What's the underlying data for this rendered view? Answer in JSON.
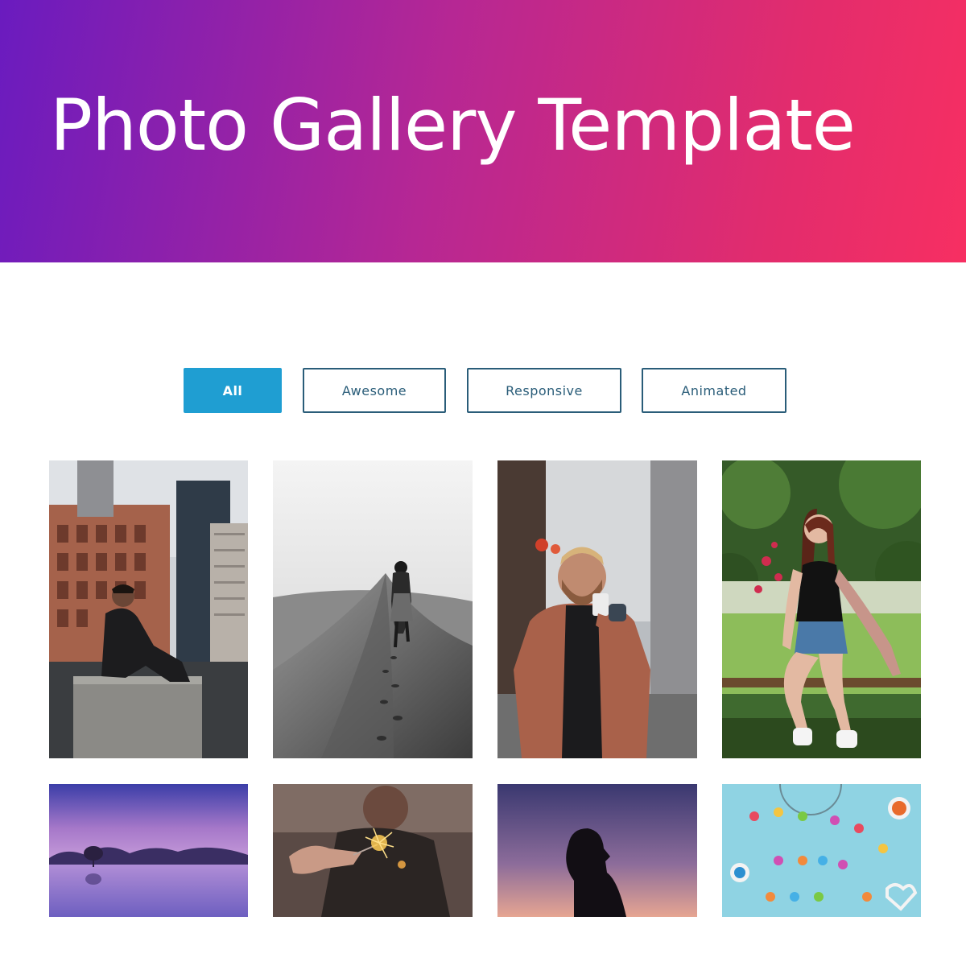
{
  "header": {
    "title": "Photo Gallery Template",
    "gradient_colors": [
      "#6a1bbf",
      "#b62794",
      "#e22c6d",
      "#f72f62"
    ]
  },
  "filters": {
    "items": [
      {
        "label": "All",
        "active": true
      },
      {
        "label": "Awesome",
        "active": false
      },
      {
        "label": "Responsive",
        "active": false
      },
      {
        "label": "Animated",
        "active": false
      }
    ],
    "active_color": "#1f9ed2",
    "border_color": "#2a5d79"
  },
  "gallery": {
    "items": [
      {
        "subject": "man-sitting-on-rooftop-city"
      },
      {
        "subject": "woman-walking-on-sand-dune-bw"
      },
      {
        "subject": "man-drinking-coffee-in-alley"
      },
      {
        "subject": "woman-sitting-on-fence-in-garden"
      },
      {
        "subject": "lone-tree-in-lake-purple-sky"
      },
      {
        "subject": "person-holding-sparkler"
      },
      {
        "subject": "silhouette-at-dusk"
      },
      {
        "subject": "candy-store-letters"
      }
    ]
  }
}
